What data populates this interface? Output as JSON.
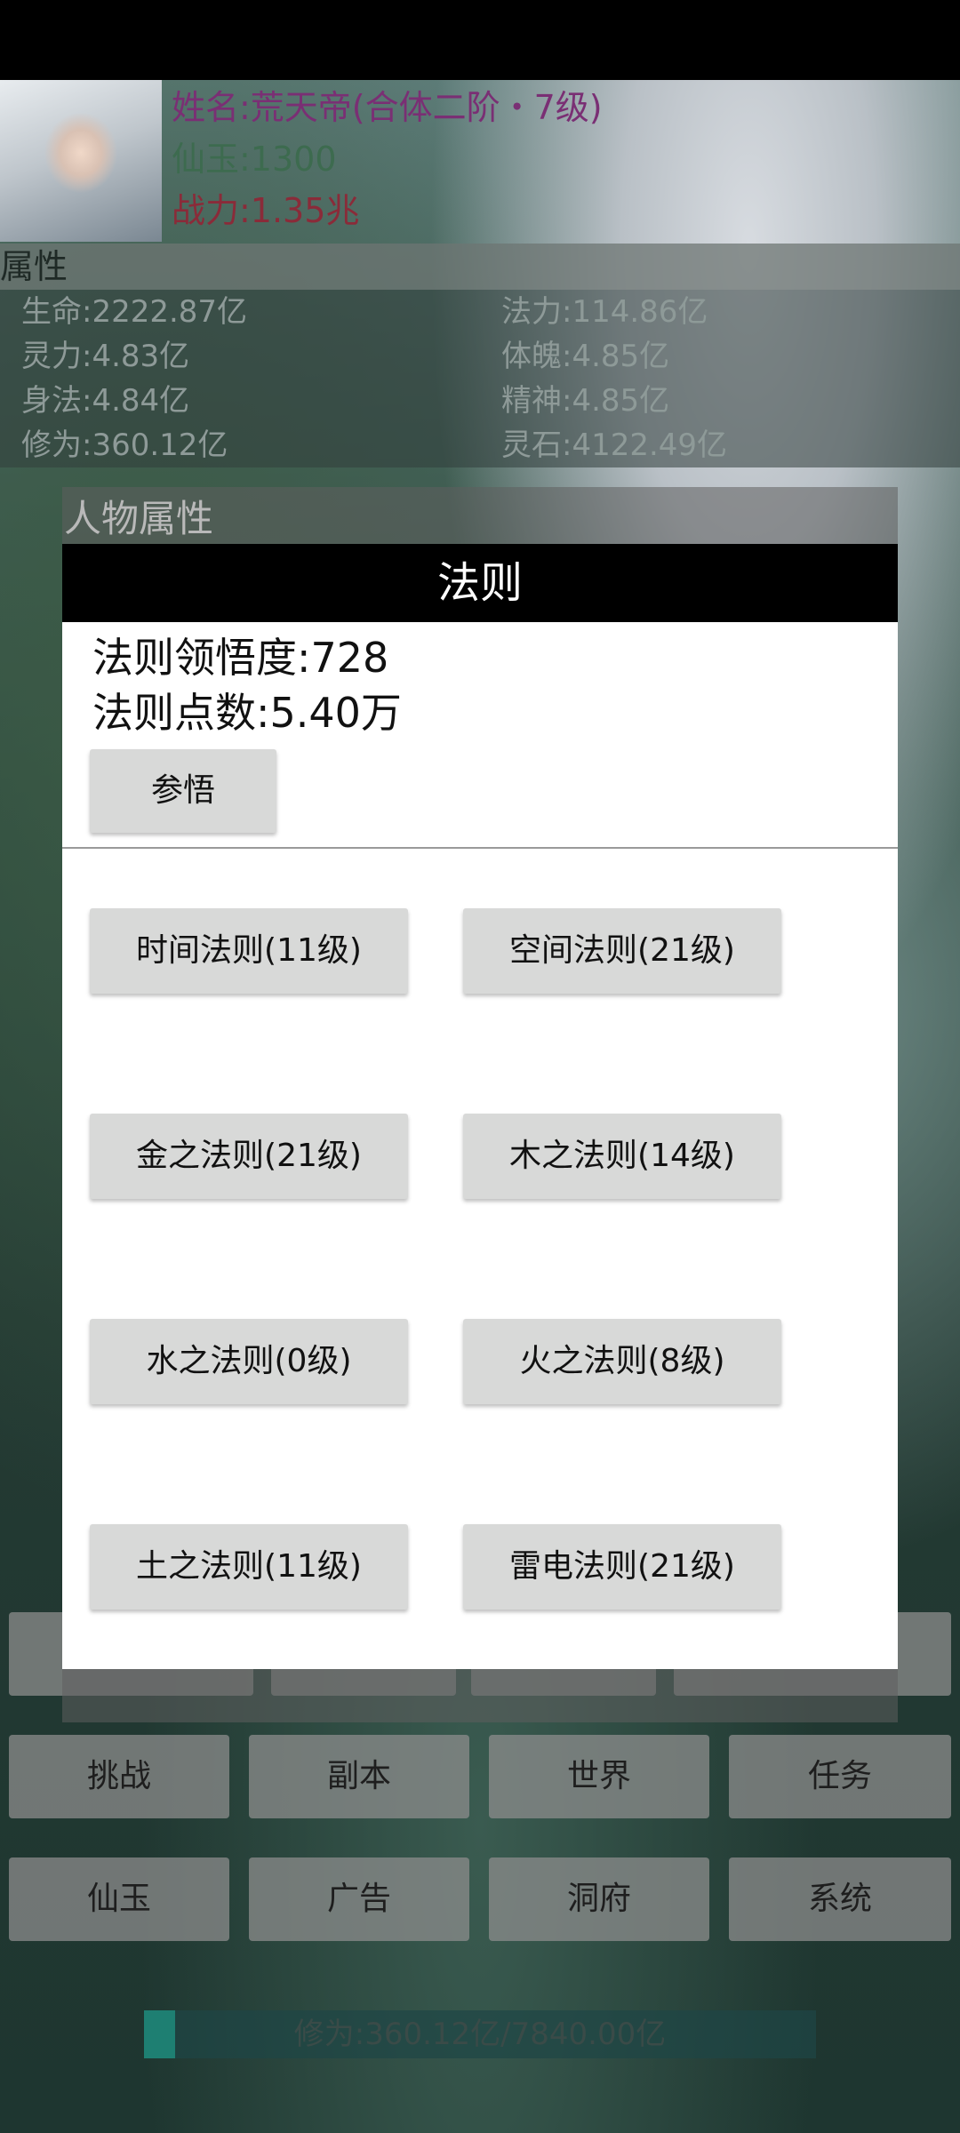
{
  "character": {
    "name": "姓名:荒天帝(合体二阶・7级)",
    "jade": "仙玉:1300",
    "power": "战力:1.35兆"
  },
  "attributes": {
    "header": "属性",
    "items": [
      "生命:2222.87亿",
      "法力:114.86亿",
      "灵力:4.83亿",
      "体魄:4.85亿",
      "身法:4.84亿",
      "精神:4.85亿",
      "修为:360.12亿",
      "灵石:4122.49亿"
    ]
  },
  "dialog": {
    "back_title": "人物属性",
    "title": "法则",
    "comprehension": "法则领悟度:728",
    "points": "法则点数:5.40万",
    "comprehend_button": "参悟",
    "laws": [
      "时间法则(11级)",
      "空间法则(21级)",
      "金之法则(21级)",
      "木之法则(14级)",
      "水之法则(0级)",
      "火之法则(8级)",
      "土之法则(11级)",
      "雷电法则(21级)"
    ]
  },
  "menu": {
    "row1": [
      "挑战",
      "副本",
      "世界",
      "任务"
    ],
    "row2": [
      "仙玉",
      "广告",
      "洞府",
      "系统"
    ]
  },
  "progress": {
    "text": "修为:360.12亿/7840.00亿",
    "fraction": 0.046
  }
}
